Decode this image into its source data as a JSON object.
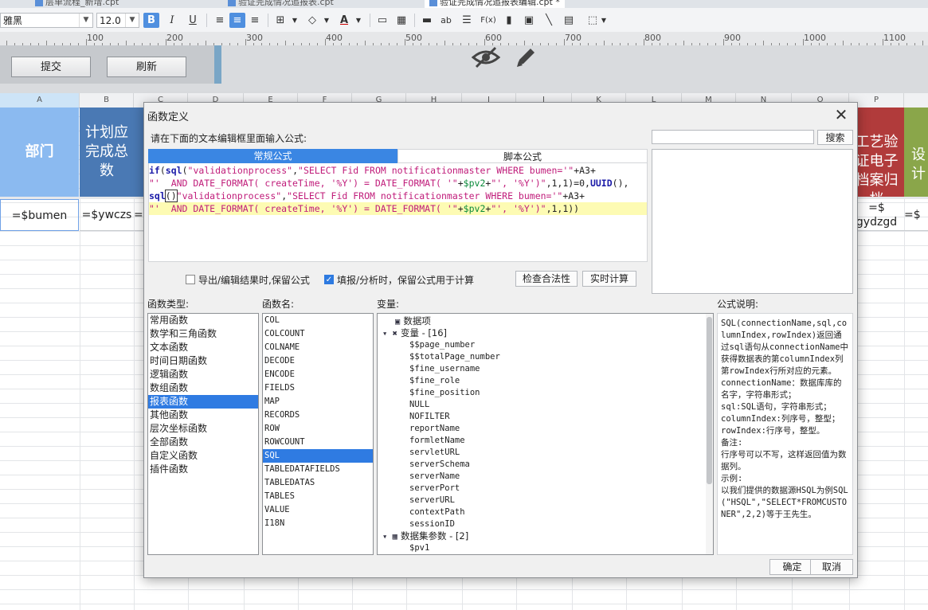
{
  "tabs": [
    {
      "label": "层单流程_新增.cpt",
      "active": false
    },
    {
      "label": "验证完成情况追报表.cpt",
      "active": false
    },
    {
      "label": "验证完成情况追报表编辑.cpt *",
      "active": true
    }
  ],
  "toolbar": {
    "font_name": "雅黑",
    "font_size": "12.0",
    "bold": "B",
    "italic": "I",
    "underline": "U",
    "fx": "F(x)",
    "ab": "ab"
  },
  "ruler": {
    "labels": [
      "100",
      "200",
      "300",
      "400",
      "500",
      "600",
      "700",
      "800",
      "900",
      "1000",
      "1100"
    ]
  },
  "param_panel": {
    "submit": "提交",
    "refresh": "刷新"
  },
  "sheet": {
    "columns": [
      "A",
      "B",
      "C",
      "D",
      "E",
      "F",
      "G",
      "H",
      "I",
      "J",
      "K",
      "L",
      "M",
      "N",
      "O",
      "P"
    ],
    "header_cells": {
      "a": "部门",
      "b": "计划应完成总数",
      "p": "工艺验证电子档案归档",
      "q": "设计"
    },
    "data_cells": {
      "a": "=$bumen",
      "b": "=$ywczs",
      "c": "=",
      "p": "=$\ngydzgd",
      "q": "=$"
    },
    "colors": {
      "header_a": "#8bbaf0",
      "header_b": "#4a79b4",
      "header_p": "#b13b3b",
      "header_q": "#8aa64a"
    }
  },
  "dialog": {
    "title": "函数定义",
    "prompt": "请在下面的文本编辑框里面输入公式:",
    "search_placeholder": "",
    "search_btn": "搜索",
    "tab_normal": "常规公式",
    "tab_script": "脚本公式",
    "formula_lines": [
      [
        [
          "fn",
          "if"
        ],
        [
          "pl",
          "("
        ],
        [
          "fn",
          "sql"
        ],
        [
          "pl",
          "("
        ],
        [
          "str",
          "\"validationprocess\""
        ],
        [
          "pl",
          ","
        ],
        [
          "str",
          "\"SELECT Fid FROM notificationmaster WHERE bumen='\""
        ],
        [
          "pl",
          "+A3+"
        ]
      ],
      [
        [
          "str",
          "\"'  AND DATE_FORMAT( createTime, '%Y') = DATE_FORMAT( '\""
        ],
        [
          "pl",
          "+"
        ],
        [
          "var",
          "$pv2"
        ],
        [
          "pl",
          "+"
        ],
        [
          "str",
          "\"', '%Y')\""
        ],
        [
          "pl",
          ",1,1)=0,"
        ],
        [
          "fn",
          "UUID"
        ],
        [
          "pl",
          "(),"
        ]
      ],
      [
        [
          "fn",
          "sql"
        ],
        [
          "pl",
          "()"
        ],
        [
          "str",
          "\"validationprocess\""
        ],
        [
          "pl",
          ","
        ],
        [
          "str",
          "\"SELECT Fid FROM notificationmaster WHERE bumen='\""
        ],
        [
          "pl",
          "+A3+"
        ]
      ],
      [
        [
          "str",
          "\"'  AND DATE_FORMAT( createTime, '%Y') = DATE_FORMAT( '\""
        ],
        [
          "pl",
          "+"
        ],
        [
          "var",
          "$pv2"
        ],
        [
          "pl",
          "+"
        ],
        [
          "str",
          "\"', '%Y')\""
        ],
        [
          "pl",
          ",1,1))"
        ]
      ]
    ],
    "chk_export": "导出/编辑结果时,保留公式",
    "chk_fill": "填报/分析时，保留公式用于计算",
    "btn_check": "检查合法性",
    "btn_realtime": "实时计算",
    "label_types": "函数类型:",
    "label_names": "函数名:",
    "label_vars": "变量:",
    "label_desc": "公式说明:",
    "function_types": [
      "常用函数",
      "数学和三角函数",
      "文本函数",
      "时间日期函数",
      "逻辑函数",
      "数组函数",
      "报表函数",
      "其他函数",
      "层次坐标函数",
      "全部函数",
      "自定义函数",
      "插件函数"
    ],
    "selected_type": "报表函数",
    "function_names": [
      "COL",
      "COLCOUNT",
      "COLNAME",
      "DECODE",
      "ENCODE",
      "FIELDS",
      "MAP",
      "RECORDS",
      "ROW",
      "ROWCOUNT",
      "SQL",
      "TABLEDATAFIELDS",
      "TABLEDATAS",
      "TABLES",
      "VALUE",
      "I18N"
    ],
    "selected_name": "SQL",
    "variables": {
      "data_item": "数据项",
      "var_group": "变量 - [16]",
      "var_items": [
        "$$page_number",
        "$$totalPage_number",
        "$fine_username",
        "$fine_role",
        "$fine_position",
        "NULL",
        "NOFILTER",
        "reportName",
        "formletName",
        "servletURL",
        "serverSchema",
        "serverName",
        "serverPort",
        "serverURL",
        "contextPath",
        "sessionID"
      ],
      "ds_group": "数据集参数 - [2]",
      "ds_items": [
        "$pv1"
      ]
    },
    "description": "SQL(connectionName,sql,columnIndex,rowIndex)返回通过sql语句从connectionName中获得数据表的第columnIndex列第rowIndex行所对应的元素。\nconnectionName：数据库库的名字，字符串形式；\nsql:SQL语句，字符串形式；\ncolumnIndex:列序号，整型；\nrowIndex:行序号，整型。\n备注:\n行序号可以不写，这样返回值为数据列。\n示例:\n以我们提供的数据源HSQL为例SQL(\"HSQL\",\"SELECT*FROMCUSTONER\",2,2)等于王先生。",
    "ok": "确定",
    "cancel": "取消"
  }
}
